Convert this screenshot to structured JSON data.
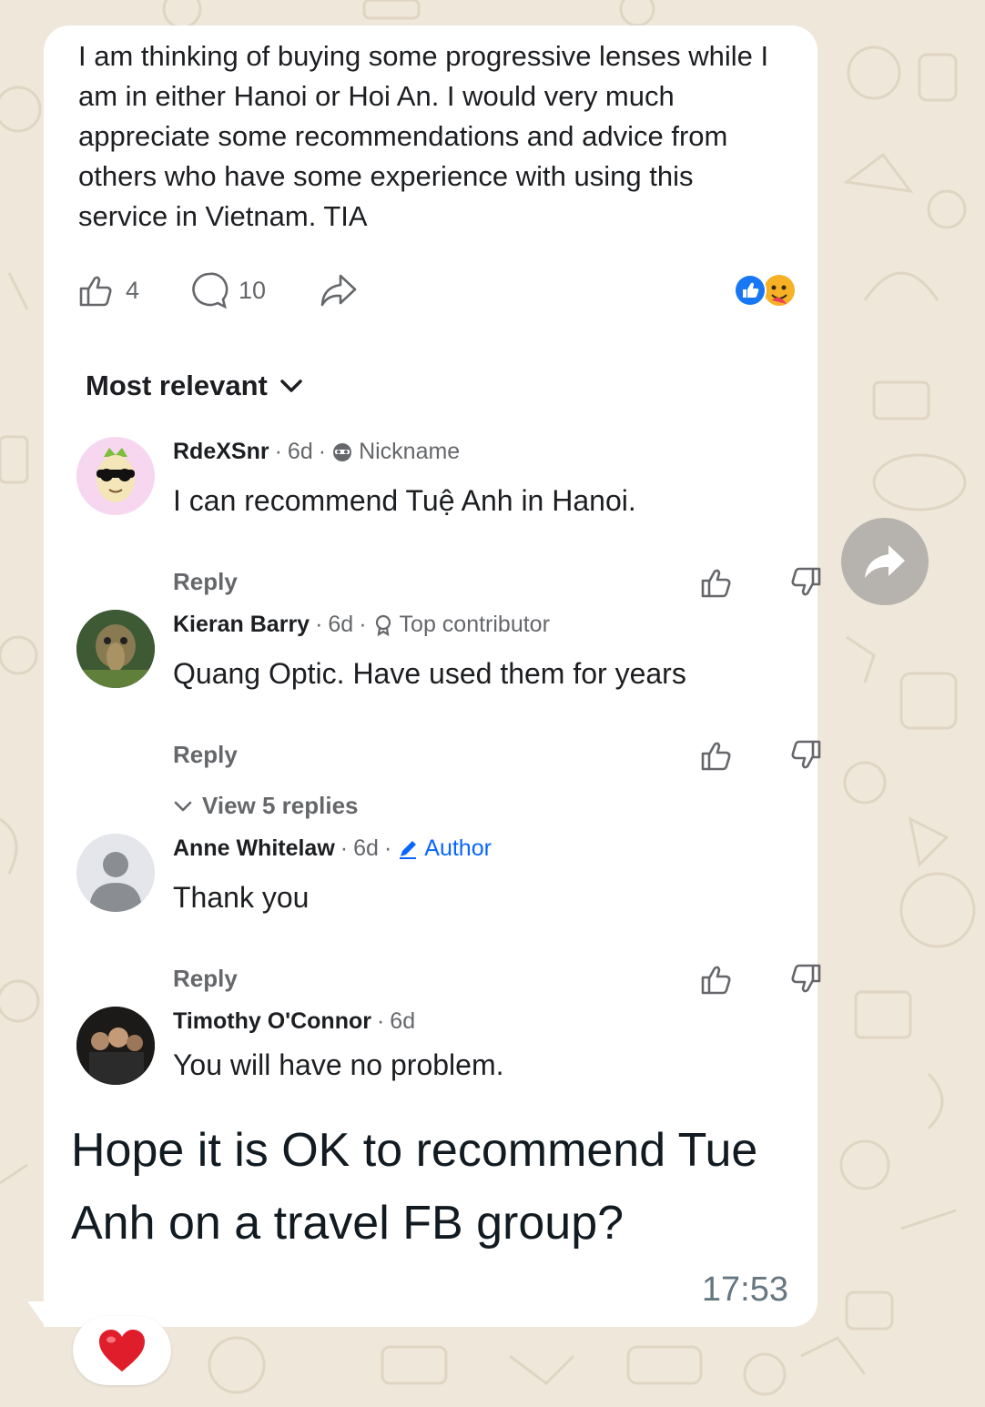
{
  "post": {
    "text": "I am thinking of buying some progressive lenses while I am in either Hanoi or Hoi An. I would very much appreciate some recommendations and advice from others who have some experience with using this service in Vietnam. TIA",
    "like_count": "4",
    "comment_count": "10"
  },
  "sort": {
    "label": "Most relevant"
  },
  "comments": [
    {
      "name": "RdeXSnr",
      "time": "6d",
      "badge": "Nickname",
      "text": "I can recommend Tuệ Anh in Hanoi.",
      "reply": "Reply"
    },
    {
      "name": "Kieran Barry",
      "time": "6d",
      "badge": "Top contributor",
      "text": "Quang Optic. Have used them for years",
      "reply": "Reply",
      "view_replies": "View 5 replies"
    },
    {
      "name": "Anne Whitelaw",
      "time": "6d",
      "badge": "Author",
      "text": "Thank you",
      "reply": "Reply"
    },
    {
      "name": "Timothy O'Connor",
      "time": "6d",
      "text": "You will have no problem."
    }
  ],
  "message": {
    "text": "Hope it is OK to recommend Tue Anh on a travel FB group?",
    "time": "17:53",
    "reaction": "❤️"
  },
  "colors": {
    "wallpaper": "#efe7da",
    "bubble": "#ffffff",
    "author_badge": "#0866ff",
    "secondary_text": "#65676b"
  }
}
